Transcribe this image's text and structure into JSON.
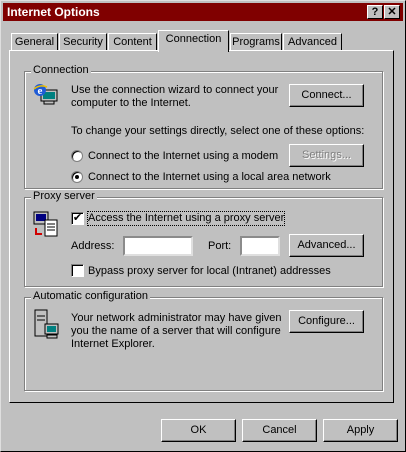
{
  "window": {
    "title": "Internet Options",
    "help_glyph": "?",
    "close_glyph": "✕"
  },
  "tabs": [
    "General",
    "Security",
    "Content",
    "Connection",
    "Programs",
    "Advanced"
  ],
  "connection": {
    "group_label": "Connection",
    "wizard_text_1": "Use the connection wizard to connect your",
    "wizard_text_2": "computer to the Internet.",
    "connect_button": "Connect...",
    "change_text": "To change your settings directly, select one of these options:",
    "option_modem": "Connect to the Internet using a modem",
    "option_lan": "Connect to the Internet using a local area network",
    "selected_option": "Connect to the Internet using a local area network",
    "settings_button": "Settings..."
  },
  "proxy": {
    "group_label": "Proxy server",
    "use_proxy_label": "Access the Internet using a proxy server",
    "use_proxy_checked": "✔",
    "address_label": "Address:",
    "address_value": "",
    "port_label": "Port:",
    "port_value": "",
    "advanced_button": "Advanced...",
    "bypass_label": "Bypass proxy server for local (Intranet) addresses",
    "bypass_checked": ""
  },
  "autoconfig": {
    "group_label": "Automatic configuration",
    "text_1": "Your network administrator may have given",
    "text_2": "you the name of a server that will configure",
    "text_3": "Internet Explorer.",
    "configure_button": "Configure..."
  },
  "footer": {
    "ok": "OK",
    "cancel": "Cancel",
    "apply": "Apply"
  },
  "colors": {
    "title_bar": "#800000",
    "face": "#c0c0c0"
  }
}
